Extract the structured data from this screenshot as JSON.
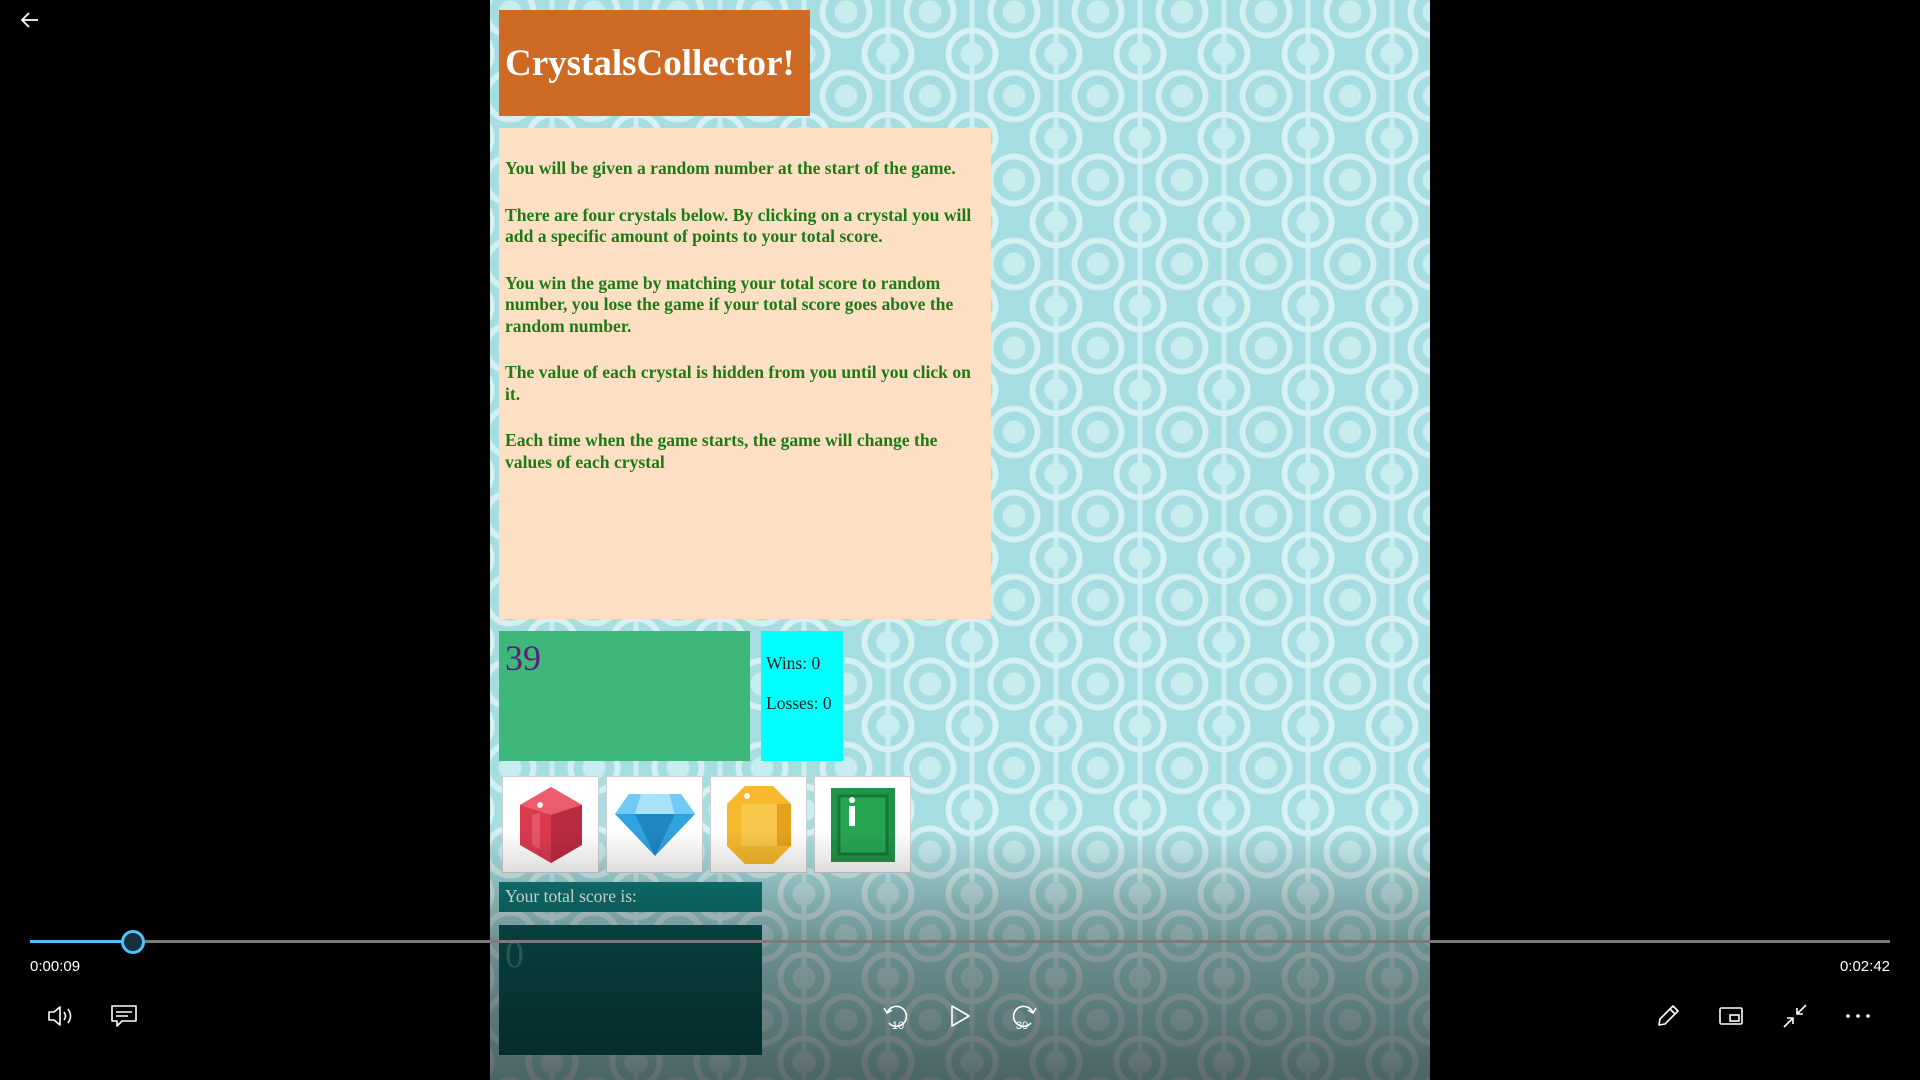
{
  "game": {
    "title": "CrystalsCollector!",
    "instructions": [
      "You will be given a random number at the start of the game.",
      "There are four crystals below. By clicking on a crystal you will add a specific amount of points to your total score.",
      "You win the game by matching your total score to random number, you lose the game if your total score goes above the random number.",
      "The value of each crystal is hidden from you until you click on it.",
      "Each time when the game starts, the game will change the values of each crystal"
    ],
    "target_number": "39",
    "wins": "Wins: 0",
    "losses": "Losses: 0",
    "crystals": [
      "red-gem-icon",
      "blue-diamond-icon",
      "yellow-gem-icon",
      "green-gem-icon"
    ],
    "score_label": "Your total score is:",
    "total_score": "0"
  },
  "player": {
    "current_time": "0:00:09",
    "total_time": "0:02:42",
    "progress": 0.0556,
    "skip_back_seconds": "10",
    "skip_forward_seconds": "30",
    "accent_color": "#4cc2ff"
  }
}
